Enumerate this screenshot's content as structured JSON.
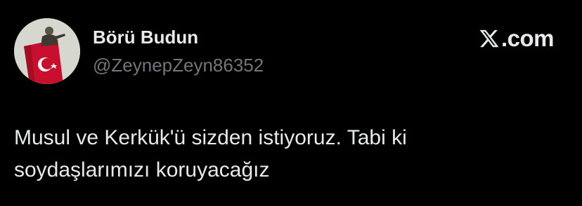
{
  "author": {
    "display_name": "Börü Budun",
    "handle": "@ZeynepZeyn86352",
    "avatar_icon": "avatar-statue-with-flag"
  },
  "brand": {
    "icon": "x-logo-icon",
    "text": ".com"
  },
  "tweet": {
    "lines": [
      "Musul ve Kerkük'ü sizden istiyoruz. Tabi ki",
      "soydaşlarımızı koruyacağız"
    ]
  },
  "colors": {
    "background": "#000000",
    "text_primary": "#e7e9ea",
    "text_secondary": "#71767b",
    "flag_red": "#c8102e"
  }
}
